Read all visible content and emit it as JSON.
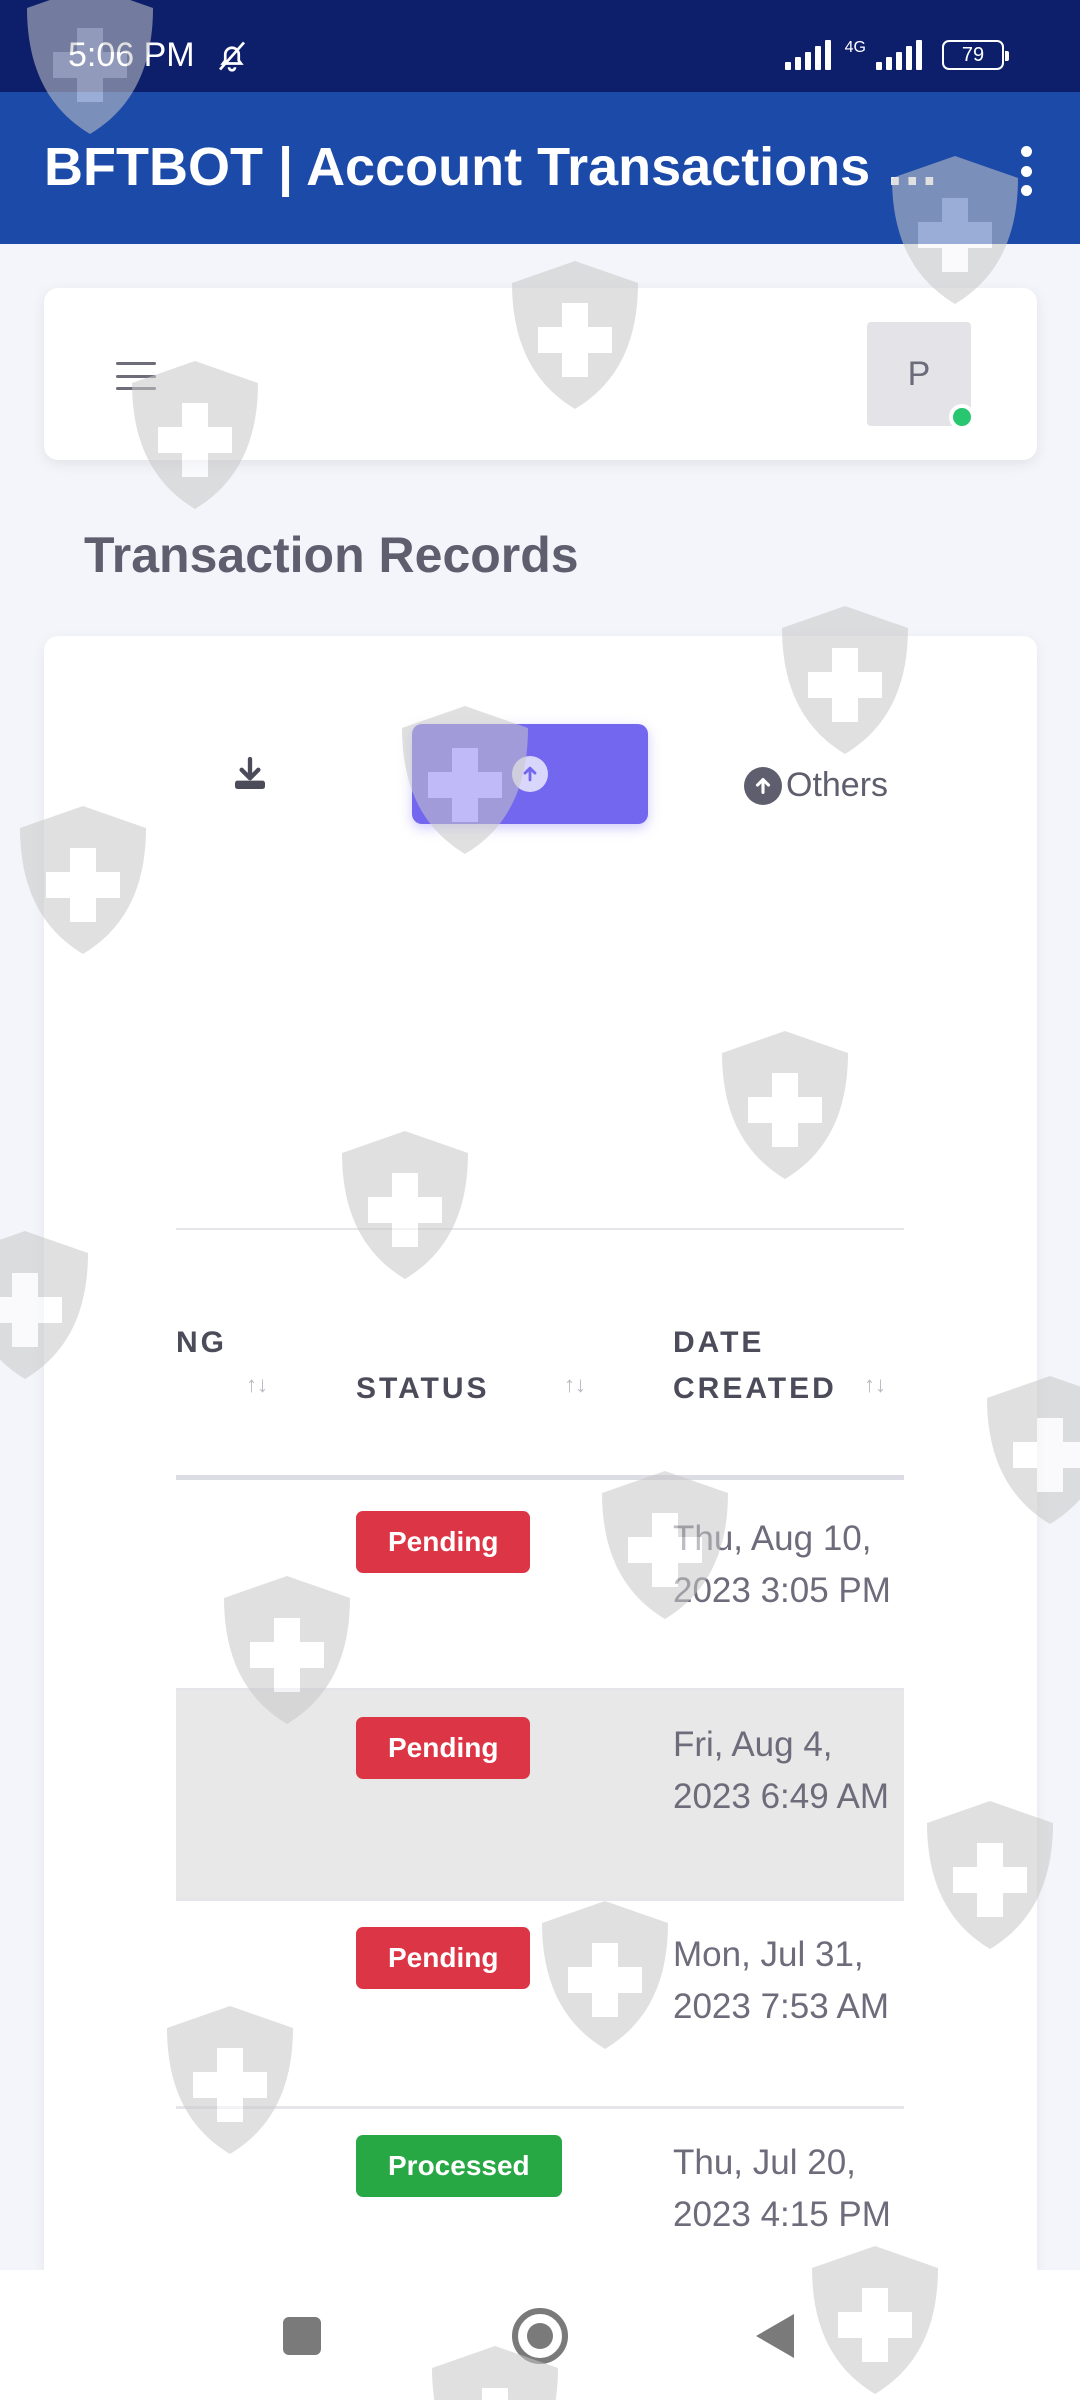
{
  "status_bar": {
    "time": "5:06 PM",
    "network": "4G",
    "battery": "79"
  },
  "app_bar": {
    "title": "BFTBOT | Account Transactions Hi..."
  },
  "top_nav": {
    "avatar_initial": "P"
  },
  "page": {
    "title": "Transaction Records"
  },
  "tabs": {
    "others_label": "Others"
  },
  "table": {
    "columns": [
      {
        "label": "NG"
      },
      {
        "label": "STATUS"
      },
      {
        "label": "DATE CREATED"
      }
    ],
    "sort_glyph": "↑↓",
    "rows": [
      {
        "status": "Pending",
        "date": "Thu, Aug 10, 2023 3:05 PM"
      },
      {
        "status": "Pending",
        "date": "Fri, Aug 4, 2023 6:49 AM"
      },
      {
        "status": "Pending",
        "date": "Mon, Jul 31, 2023 7:53 AM"
      },
      {
        "status": "Processed",
        "date": "Thu, Jul 20, 2023 4:15 PM"
      }
    ]
  },
  "colors": {
    "status_bar": "#0d1f6b",
    "app_bar": "#1c4aa8",
    "primary": "#7367f0",
    "pending": "#dc3545",
    "processed": "#28a745",
    "online": "#28c76f"
  }
}
